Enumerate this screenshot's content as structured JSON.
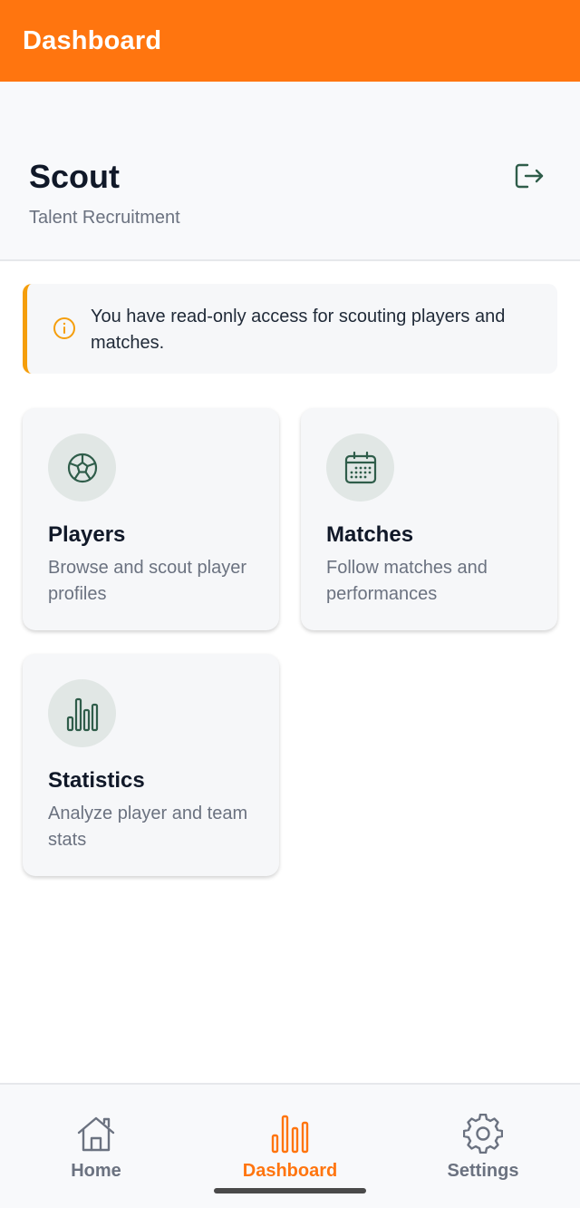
{
  "appbar": {
    "title": "Dashboard",
    "color": "#ff750f"
  },
  "header": {
    "title": "Scout",
    "subtitle": "Talent Recruitment",
    "logout_icon": "logout-icon"
  },
  "notice": {
    "icon": "info-icon",
    "text": "You have read-only access for scouting players and matches.",
    "accent": "#f59e0b"
  },
  "cards": [
    {
      "icon": "soccer-ball-icon",
      "title": "Players",
      "description": "Browse and scout player profiles"
    },
    {
      "icon": "calendar-icon",
      "title": "Matches",
      "description": "Follow matches and performances"
    },
    {
      "icon": "bar-chart-icon",
      "title": "Statistics",
      "description": "Analyze player and team stats"
    }
  ],
  "bottom_nav": {
    "items": [
      {
        "icon": "home-icon",
        "label": "Home",
        "active": false
      },
      {
        "icon": "bar-chart-icon",
        "label": "Dashboard",
        "active": true
      },
      {
        "icon": "gear-icon",
        "label": "Settings",
        "active": false
      }
    ]
  }
}
